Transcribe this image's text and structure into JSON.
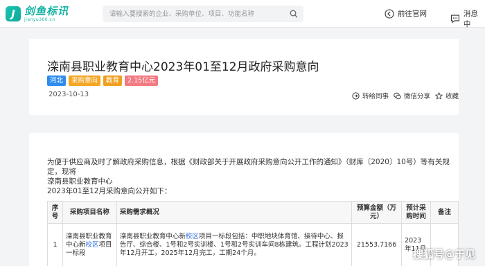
{
  "header": {
    "logo_cn": "剑鱼标讯",
    "logo_en": "jianyu360.cn",
    "search_placeholder": "请输入要搜索的企业、采购单位、项目、功能名称",
    "nav_official": "前往官网",
    "nav_messages": "消息中"
  },
  "notice": {
    "title": "滦南县职业教育中心2023年01至12月政府采购意向",
    "tags": [
      {
        "label": "河北",
        "color": "#2d8cf0"
      },
      {
        "label": "采购意向",
        "color": "#f5a623"
      },
      {
        "label": "教育",
        "color": "#f0a020"
      },
      {
        "label": "2.15亿元",
        "color": "#f27a82"
      }
    ],
    "date": "2023-10-13",
    "actions": {
      "forward": "转给同事",
      "wechat": "微信分享",
      "favorite": "收藏"
    }
  },
  "content": {
    "para1_line1": "为便于供应商及时了解政府采购信息，根据《财政部关于开展政府采购意向公开工作的通知》（财库〔2020〕10号）等有关规",
    "para1_line2": "定，现将",
    "para2": "滦南县职业教育中心",
    "para3": "2023年01至12月采购意向公开如下：",
    "table": {
      "headers": [
        "序号",
        "采购项目名称",
        "采购需求概况",
        "预算金额（万元）",
        "预计采购时间",
        "备注"
      ],
      "rows": [
        {
          "seq": "1",
          "name_prefix": "滦南县职业教育中心新",
          "name_hl": "校区",
          "name_suffix": "项目一标段",
          "req_prefix": "滦南县职业教育中心新",
          "req_hl": "校区",
          "req_suffix": "项目一标段包括：中职地块体育馆、接待中心、报告厅、综合楼、1号和2号实训楼、1号和2号实训车间8栋建筑。工程计划2023年12月开工，2025年12月完工，工期24个月。",
          "budget": "21553.7166",
          "time": "2023年11月",
          "note": ""
        }
      ]
    }
  },
  "watermark": "搜狐号@于见"
}
